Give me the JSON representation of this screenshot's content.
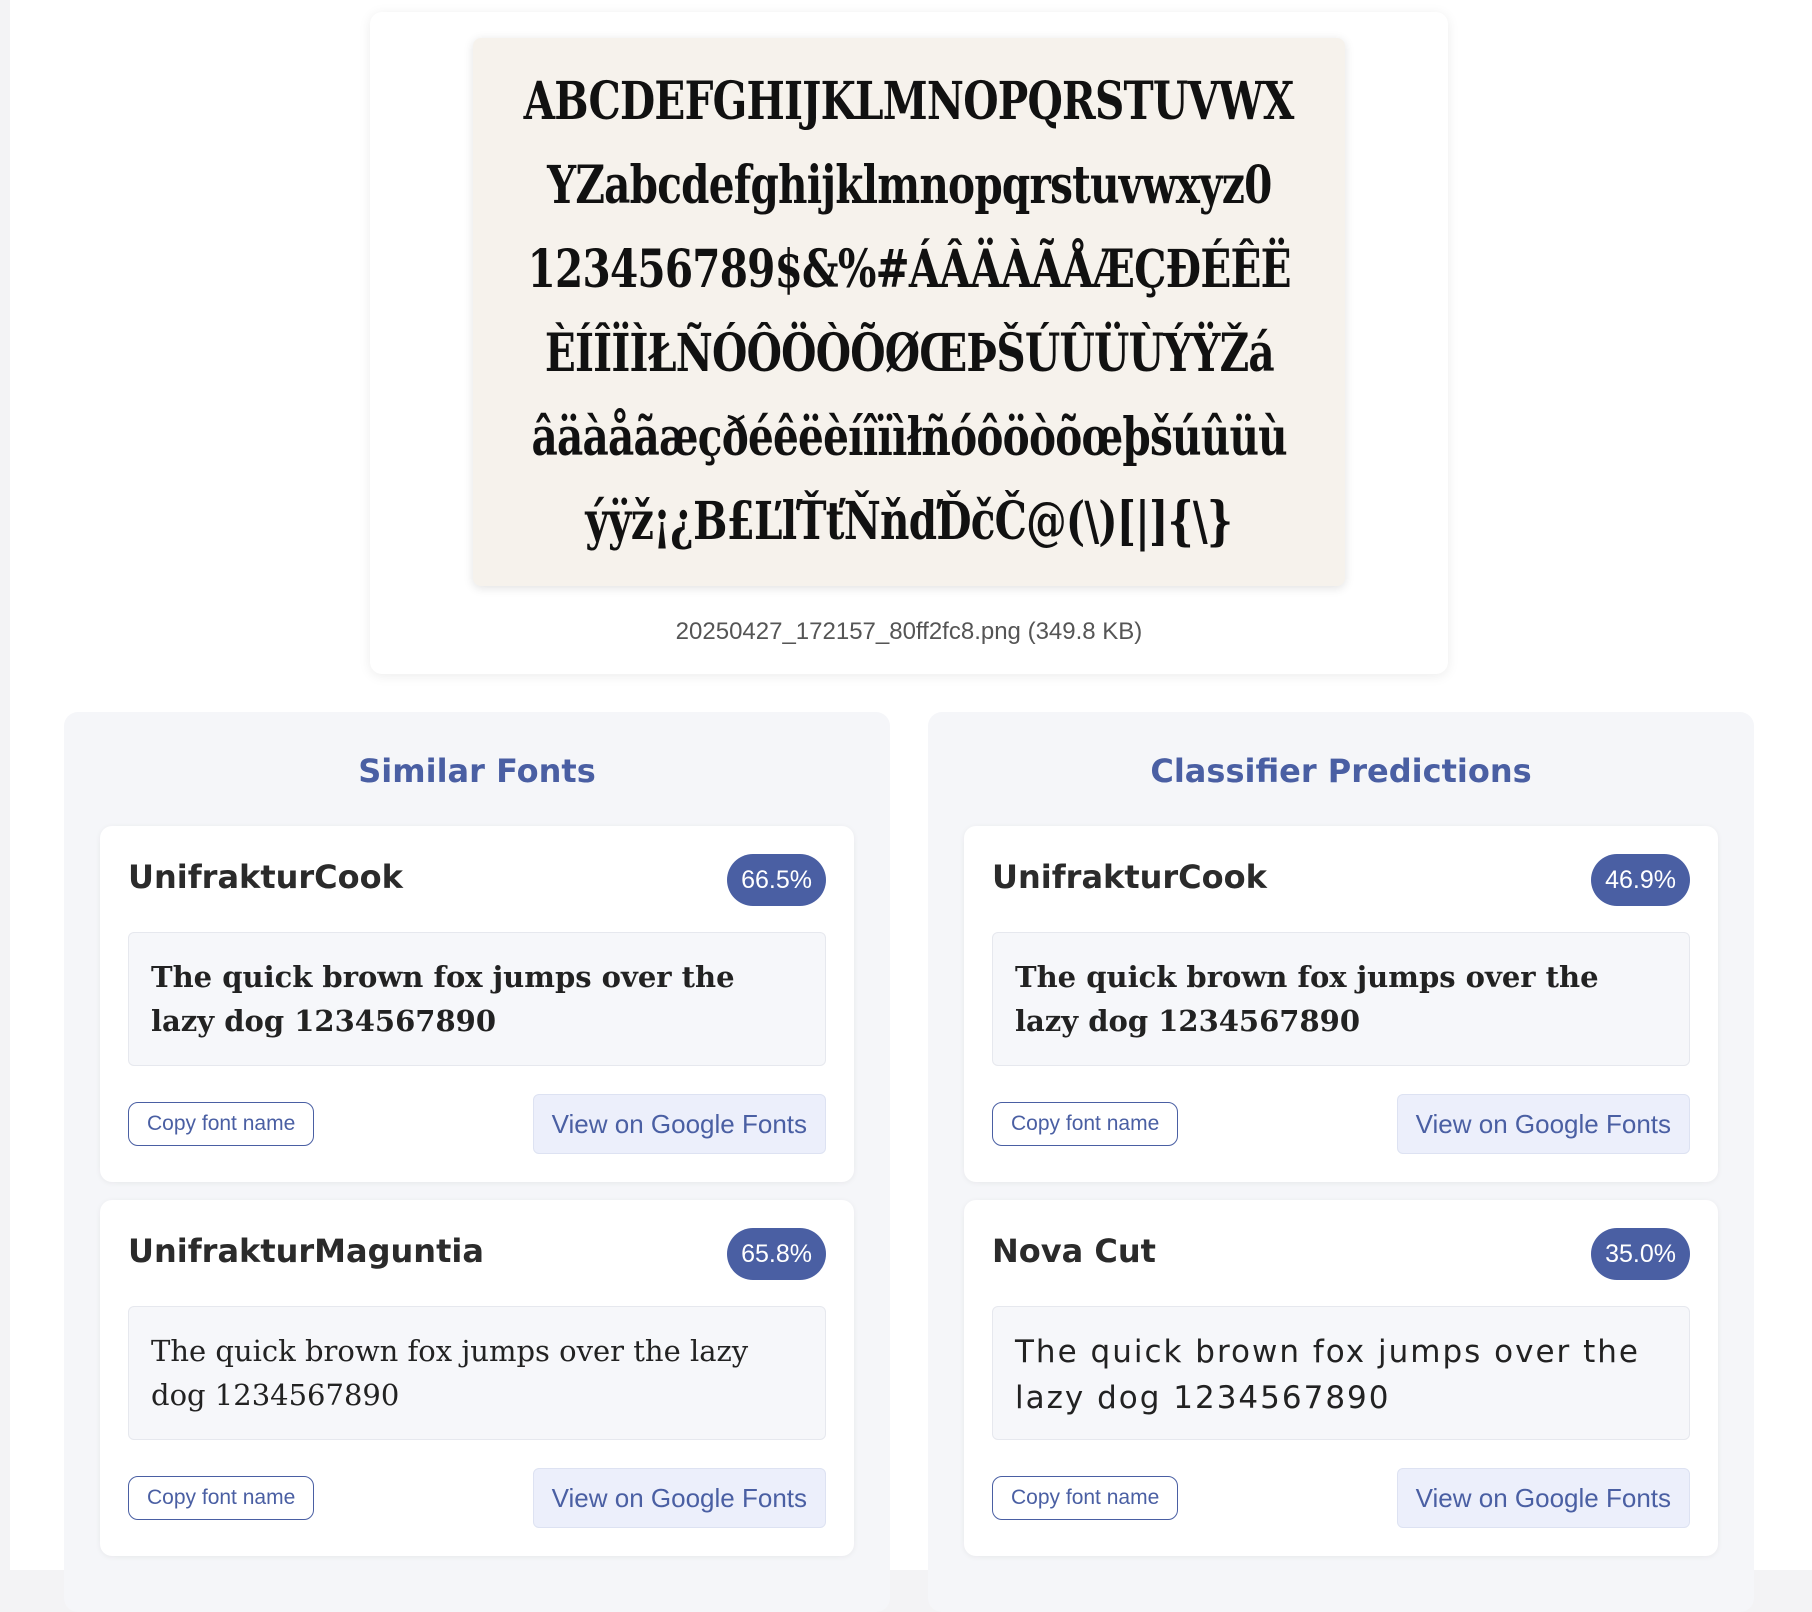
{
  "preview": {
    "specimen_lines": [
      "ABCDEFGHIJKLMNOPQRSTUVWX",
      "YZabcdefghijklmnopqrstuvwxyz0",
      "123456789$&%#ÁÂÄÀÃÅÆÇÐÉÊË",
      "ÈÍÎÏÌŁÑÓÔÖÒÕØŒÞŠÚÛÜÙÝŸŽá",
      "âäàåãæçðéêëèíîïìłñóôöòõœþšúûüù",
      "ýÿž¡¿B£ĽľŤťŇňďĎčČ@(\\)[|]{\\}"
    ],
    "file_caption": "20250427_172157_80ff2fc8.png (349.8 KB)"
  },
  "similar": {
    "title": "Similar Fonts",
    "cards": [
      {
        "name": "UnifrakturCook",
        "score": "66.5%",
        "sample": "The quick brown fox jumps over the lazy dog 1234567890",
        "copy_label": "Copy font name",
        "gf_label": "View on Google Fonts"
      },
      {
        "name": "UnifrakturMaguntia",
        "score": "65.8%",
        "sample": "The quick brown fox jumps over the lazy dog 1234567890",
        "copy_label": "Copy font name",
        "gf_label": "View on Google Fonts"
      }
    ]
  },
  "classifier": {
    "title": "Classifier Predictions",
    "cards": [
      {
        "name": "UnifrakturCook",
        "score": "46.9%",
        "sample": "The quick brown fox jumps over the lazy dog 1234567890",
        "copy_label": "Copy font name",
        "gf_label": "View on Google Fonts"
      },
      {
        "name": "Nova Cut",
        "score": "35.0%",
        "sample": "The quick brown fox jumps over the lazy dog 1234567890",
        "copy_label": "Copy font name",
        "gf_label": "View on Google Fonts"
      }
    ]
  },
  "colors": {
    "accent": "#4a5fa3",
    "specimen_background": "#f6f2ec",
    "panel_background": "#f5f6f9"
  }
}
